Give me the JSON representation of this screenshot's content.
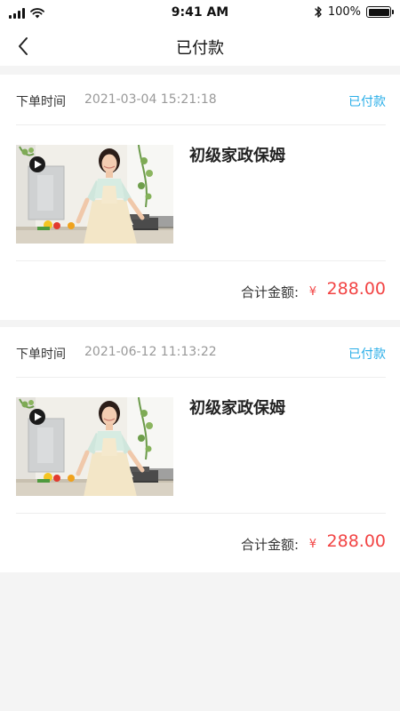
{
  "status_bar": {
    "time": "9:41 AM",
    "battery_text": "100%",
    "battery_level": 1.0
  },
  "nav": {
    "title": "已付款"
  },
  "orders": [
    {
      "time_label": "下单时间",
      "time_value": "2021-03-04 15:21:18",
      "status": "已付款",
      "product_title": "初级家政保姆",
      "total_label": "合计金额:",
      "currency": "¥",
      "amount": "288.00"
    },
    {
      "time_label": "下单时间",
      "time_value": "2021-06-12 11:13:22",
      "status": "已付款",
      "product_title": "初级家政保姆",
      "total_label": "合计金额:",
      "currency": "¥",
      "amount": "288.00"
    }
  ],
  "colors": {
    "accent": "#29aee8",
    "price": "#f24444",
    "background": "#f4f4f4"
  },
  "icons": [
    "signal-icon",
    "wifi-icon",
    "bluetooth-icon",
    "battery-icon",
    "back-arrow-icon",
    "play-icon"
  ]
}
